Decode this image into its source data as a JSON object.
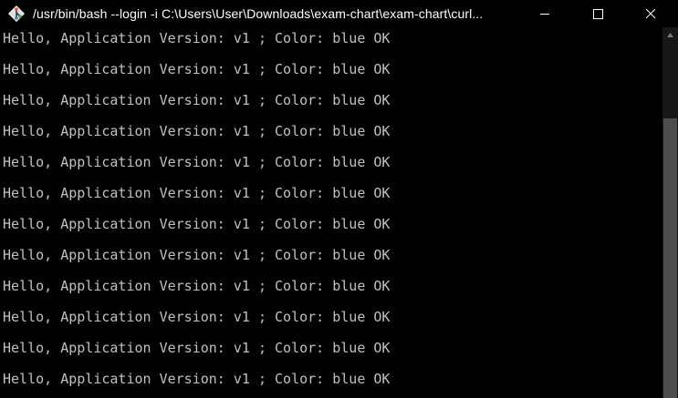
{
  "window": {
    "title": "/usr/bin/bash --login -i C:\\Users\\User\\Downloads\\exam-chart\\exam-chart\\curl...",
    "icon": "git-bash-icon",
    "controls": {
      "minimize_icon": "minimize-icon",
      "maximize_icon": "maximize-icon",
      "close_icon": "close-icon"
    }
  },
  "colors": {
    "background": "#000000",
    "text": "#c0c0c0",
    "title_text": "#ffffff",
    "scrollbar_track": "#171717",
    "scrollbar_thumb": "#4d4d4d"
  },
  "terminal": {
    "lines": [
      "Hello, Application Version: v1 ; Color: blue OK",
      "Hello, Application Version: v1 ; Color: blue OK",
      "Hello, Application Version: v1 ; Color: blue OK",
      "Hello, Application Version: v1 ; Color: blue OK",
      "Hello, Application Version: v1 ; Color: blue OK",
      "Hello, Application Version: v1 ; Color: blue OK",
      "Hello, Application Version: v1 ; Color: blue OK",
      "Hello, Application Version: v1 ; Color: blue OK",
      "Hello, Application Version: v1 ; Color: blue OK",
      "Hello, Application Version: v1 ; Color: blue OK",
      "Hello, Application Version: v1 ; Color: blue OK",
      "Hello, Application Version: v1 ; Color: blue OK"
    ]
  }
}
